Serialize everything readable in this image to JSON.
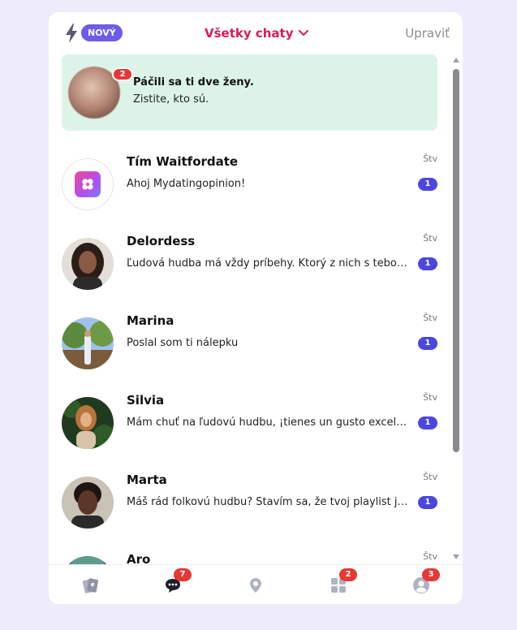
{
  "header": {
    "badge_new": "NOVÝ",
    "title": "Všetky chaty",
    "edit": "Upraviť",
    "icons": {
      "bolt": "bolt-icon",
      "dropdown": "chevron-down-icon"
    }
  },
  "promo": {
    "count": "2",
    "title": "Páčili sa ti dve ženy.",
    "subtitle": "Zistite, kto sú."
  },
  "chats": [
    {
      "name": "Tím Waitfordate",
      "message": "Ahoj Mydatingopinion!",
      "day": "Štv",
      "unread": "1"
    },
    {
      "name": "Delordess",
      "message": "Ľudová hudba má vždy príbehy. Ktorý z nich s tebou rezonuje najviac?",
      "day": "Štv",
      "unread": "1"
    },
    {
      "name": "Marina",
      "message": "Poslal som ti nálepku",
      "day": "Štv",
      "unread": "1"
    },
    {
      "name": "Silvia",
      "message": "Mám chuť na ľudovú hudbu, ¡tienes un gusto excelente!",
      "day": "Štv",
      "unread": "1"
    },
    {
      "name": "Marta",
      "message": "Máš rád folkovú hudbu? Stavím sa, že tvoj playlist je úžasný!",
      "day": "Štv",
      "unread": "1"
    },
    {
      "name": "Aro",
      "message": "",
      "day": "Štv",
      "unread": ""
    }
  ],
  "nav": [
    {
      "icon": "cards-icon",
      "badge": ""
    },
    {
      "icon": "chat-icon",
      "badge": "7"
    },
    {
      "icon": "map-pin-icon",
      "badge": ""
    },
    {
      "icon": "grid-icon",
      "badge": "2"
    },
    {
      "icon": "profile-icon",
      "badge": "3"
    }
  ],
  "colors": {
    "background": "#eeebfb",
    "accent_red": "#d81b55",
    "badge_purple": "#6c5ce7",
    "unread_blue": "#4a47e0",
    "promo_bg": "#dcf4e8",
    "notification_red": "#e53935"
  }
}
